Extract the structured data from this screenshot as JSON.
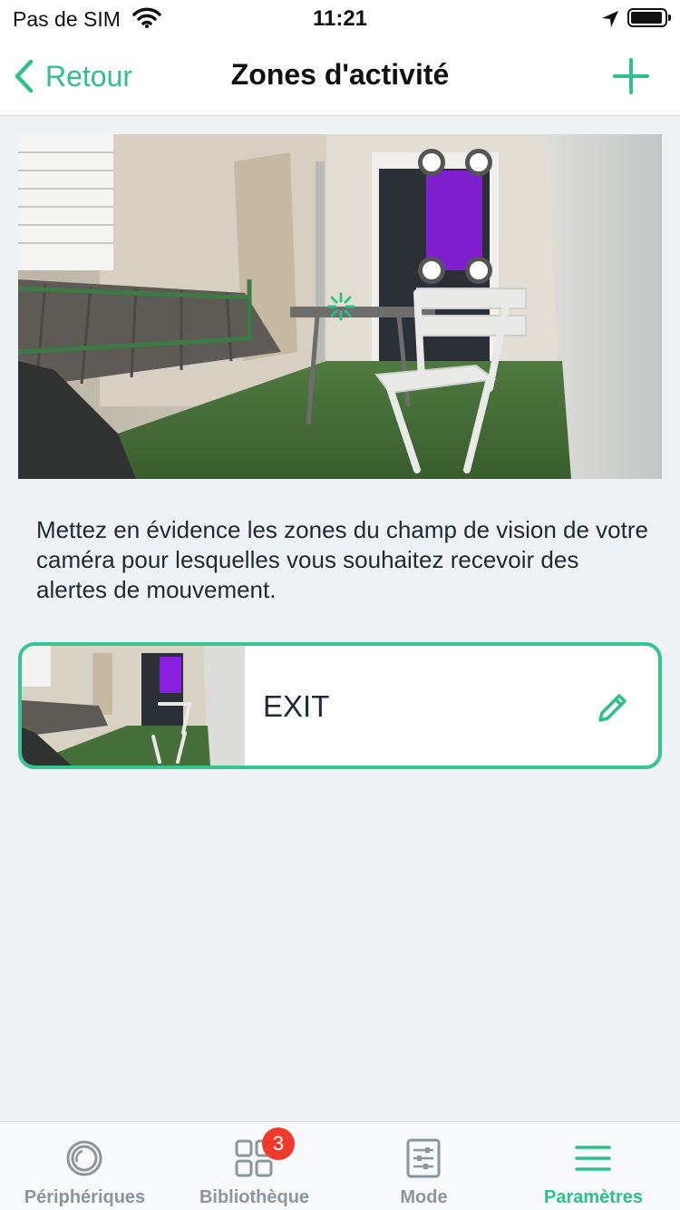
{
  "status_bar": {
    "carrier": "Pas de SIM",
    "time": "11:21"
  },
  "nav": {
    "back_label": "Retour",
    "title": "Zones d'activité"
  },
  "description": "Mettez en évidence les zones du champ de vision de votre caméra pour lesquelles vous souhaitez recevoir des alertes de mouvement.",
  "zones": [
    {
      "name": "EXIT"
    }
  ],
  "tab_bar": {
    "tabs": [
      {
        "label": "Périphériques",
        "icon": "devices-icon"
      },
      {
        "label": "Bibliothèque",
        "icon": "library-grid-icon",
        "badge": "3"
      },
      {
        "label": "Mode",
        "icon": "mode-sliders-icon"
      },
      {
        "label": "Paramètres",
        "icon": "menu-icon",
        "active": true
      }
    ]
  },
  "colors": {
    "accent": "#2fbf8a",
    "badge": "#f03a2e",
    "zone_overlay": "#8a1ee0",
    "background": "#eff2f4"
  }
}
